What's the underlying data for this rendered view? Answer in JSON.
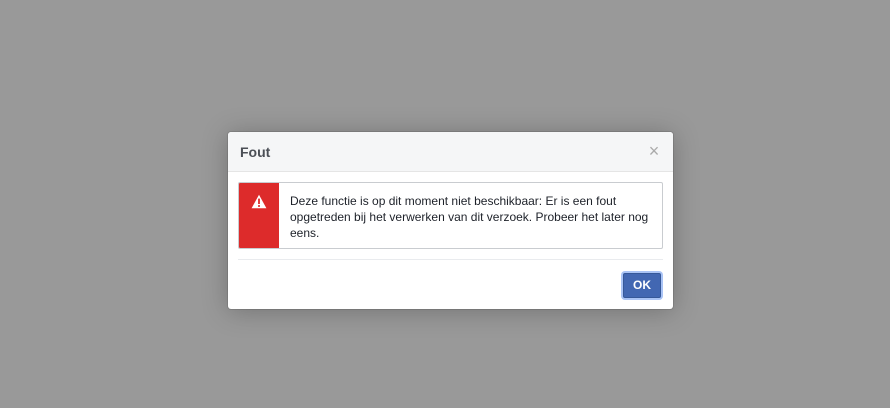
{
  "dialog": {
    "title": "Fout",
    "close_label": "×",
    "message": "Deze functie is op dit moment niet beschikbaar: Er is een fout opgetreden bij het verwerken van dit verzoek. Probeer het later nog eens.",
    "ok_label": "OK"
  },
  "icons": {
    "close": "close-icon",
    "warning": "warning-icon"
  },
  "colors": {
    "overlay": "#999999",
    "error_strip": "#dd2b2b",
    "primary_button": "#4267b2"
  }
}
